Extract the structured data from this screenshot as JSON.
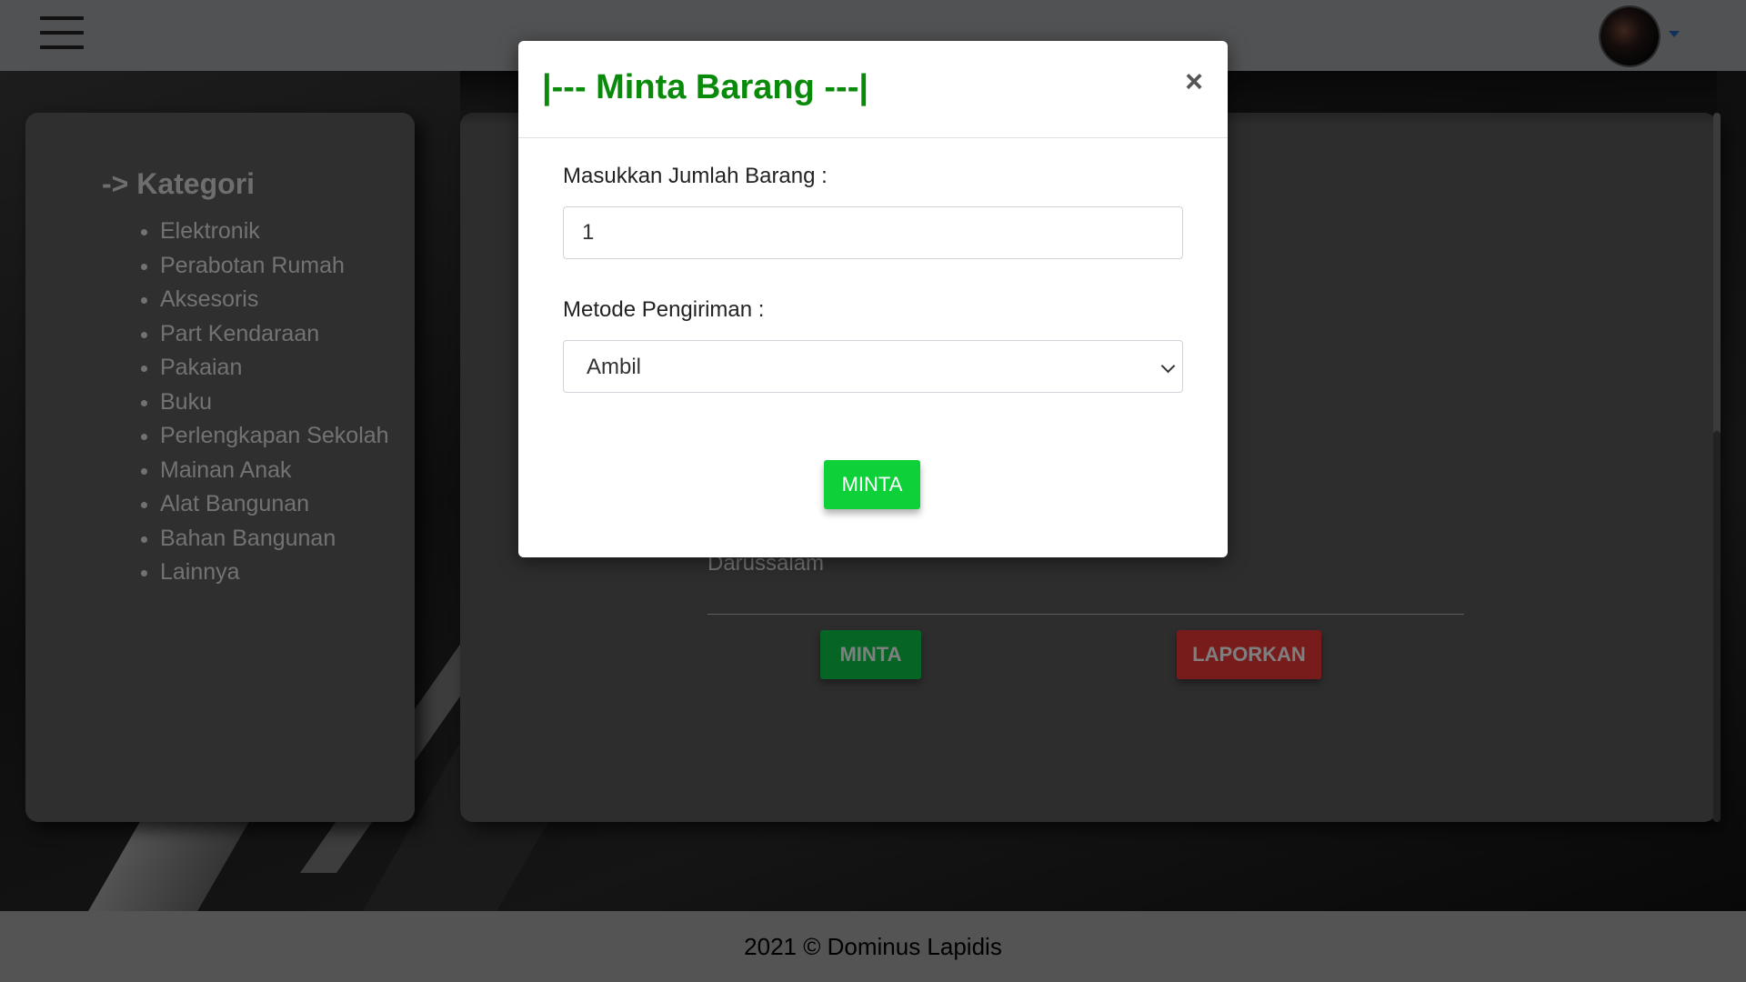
{
  "sidebar": {
    "title": "-> Kategori",
    "categories": [
      "Elektronik",
      "Perabotan Rumah",
      "Aksesoris",
      "Part Kendaraan",
      "Pakaian",
      "Buku",
      "Perlengkapan Sekolah",
      "Mainan Anak",
      "Alat Bangunan",
      "Bahan Bangunan",
      "Lainnya"
    ]
  },
  "item": {
    "location": "Darussalam",
    "request_label": "MINTA",
    "report_label": "LAPORKAN"
  },
  "footer": {
    "text": "2021 © Dominus Lapidis"
  },
  "modal": {
    "title": "|--- Minta Barang ---|",
    "close_symbol": "×",
    "quantity_label": "Masukkan Jumlah Barang :",
    "quantity_value": "1",
    "shipping_label": "Metode Pengiriman :",
    "shipping_selected": "Ambil",
    "submit_label": "MINTA"
  },
  "icons": [
    "hamburger-menu-icon",
    "avatar",
    "caret-down-icon",
    "close-icon",
    "chevron-down-icon"
  ],
  "colors": {
    "modal_title": "#0a8a0a",
    "submit_button": "#0ed13a",
    "report_button": "#f03737",
    "caret": "#1e63b8"
  }
}
